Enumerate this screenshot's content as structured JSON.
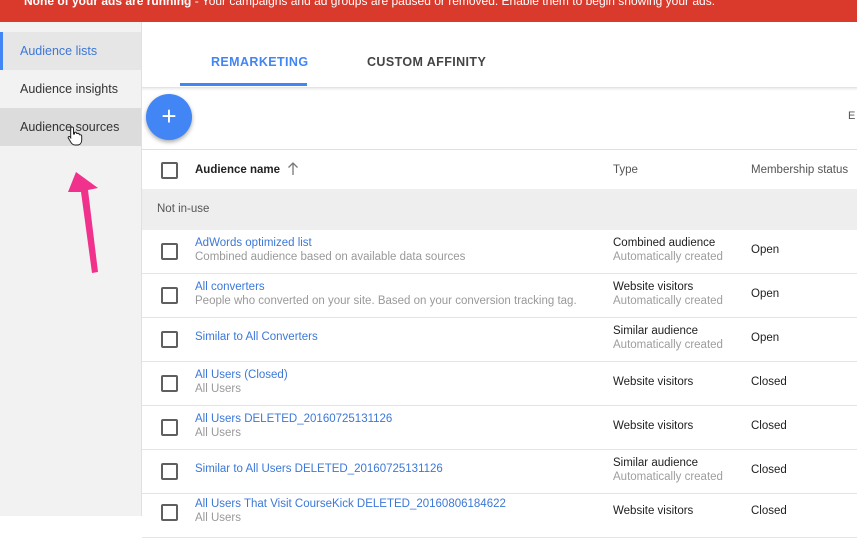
{
  "banner": {
    "bold": "None of your ads are running",
    "text": " - Your campaigns and ad groups are paused or removed. Enable them to begin showing your ads."
  },
  "sidebar": {
    "items": [
      {
        "label": "Audience lists",
        "active": true
      },
      {
        "label": "Audience insights",
        "active": false
      },
      {
        "label": "Audience sources",
        "active": false
      }
    ]
  },
  "tabs": [
    {
      "label": "REMARKETING",
      "active": true
    },
    {
      "label": "CUSTOM AFFINITY",
      "active": false
    }
  ],
  "toolbar": {
    "add_symbol": "+",
    "clipped_label": "E"
  },
  "table": {
    "columns": {
      "name": "Audience name",
      "type": "Type",
      "status": "Membership status"
    },
    "group_label": "Not in-use",
    "rows": [
      {
        "name": "AdWords optimized list",
        "description": "Combined audience based on available data sources",
        "type": "Combined audience",
        "type_note": "Automatically created",
        "status": "Open"
      },
      {
        "name": "All converters",
        "description": "People who converted on your site. Based on your conversion tracking tag.",
        "type": "Website visitors",
        "type_note": "Automatically created",
        "status": "Open"
      },
      {
        "name": "Similar to All Converters",
        "description": "",
        "type": "Similar audience",
        "type_note": "Automatically created",
        "status": "Open"
      },
      {
        "name": "All Users (Closed)",
        "description": "All Users",
        "type": "Website visitors",
        "type_note": "",
        "status": "Closed"
      },
      {
        "name": "All Users DELETED_20160725131126",
        "description": "All Users",
        "type": "Website visitors",
        "type_note": "",
        "status": "Closed"
      },
      {
        "name": "Similar to All Users DELETED_20160725131126",
        "description": "",
        "type": "Similar audience",
        "type_note": "Automatically created",
        "status": "Closed"
      },
      {
        "name": "All Users That Visit CourseKick DELETED_20160806184622",
        "description": "All Users",
        "type": "Website visitors",
        "type_note": "",
        "status": "Closed"
      }
    ]
  },
  "colors": {
    "banner": "#d93a2b",
    "accent": "#4285f4",
    "link": "#3c78d8",
    "annotation_arrow": "#f0328c"
  },
  "icons": [
    "hand-cursor-icon",
    "pink-arrow-icon",
    "add-icon",
    "sort-arrow-up-icon",
    "checkbox-icon"
  ]
}
